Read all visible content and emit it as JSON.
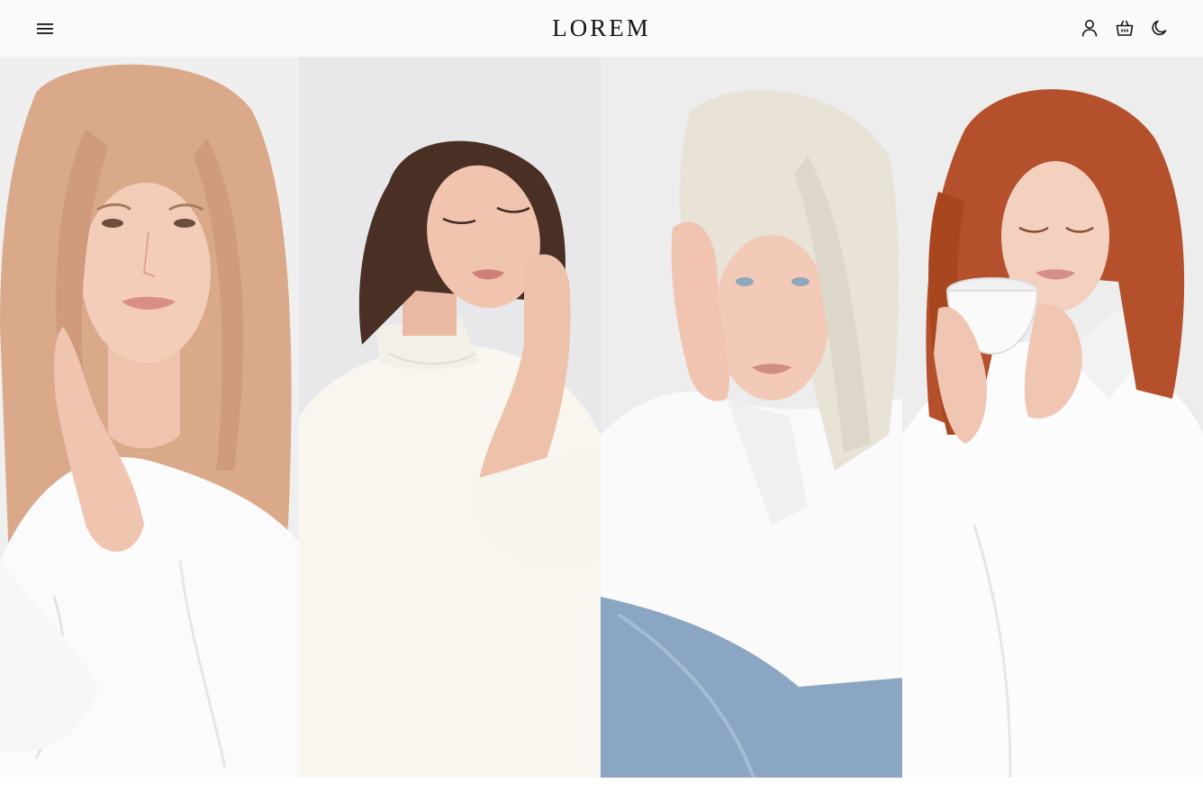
{
  "header": {
    "brand": "LOREM",
    "icons": {
      "menu": "menu-icon",
      "account": "user-icon",
      "cart": "basket-icon",
      "theme": "moon-icon"
    }
  },
  "gallery": {
    "panels": [
      {
        "subject": "model-strawberry-blonde",
        "hair_color": "#d9a98a",
        "background": "#eeeeee"
      },
      {
        "subject": "model-brunette-turtleneck",
        "hair_color": "#4a3024",
        "background": "#e7e7ea"
      },
      {
        "subject": "model-platinum-blonde",
        "hair_color": "#e8e3d6",
        "background": "#eceded"
      },
      {
        "subject": "model-redhead-cup",
        "hair_color": "#b4502c",
        "background": "#ededed"
      }
    ]
  },
  "colors": {
    "header_bg": "#fafafa",
    "text": "#151515",
    "skin": "#f1c8b5",
    "shirt": "#fbfbfb",
    "denim": "#8aa6c2"
  }
}
